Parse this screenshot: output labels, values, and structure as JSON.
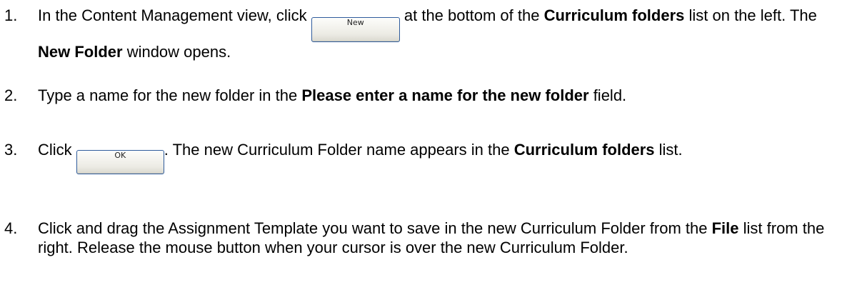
{
  "steps": [
    {
      "number": "1.",
      "text_a": "In the Content Management view, click ",
      "button_label": "New",
      "text_b": " at the bottom of the ",
      "bold_1": "Curriculum folders",
      "text_c": " list on the left. The ",
      "bold_2": "New Folder",
      "text_d": " window opens."
    },
    {
      "number": "2.",
      "text_a": "Type a name for the new folder in the ",
      "bold_1": "Please enter a name for the new folder",
      "text_b": " field."
    },
    {
      "number": "3.",
      "text_a": "Click ",
      "button_label": "OK",
      "text_b": ". The new Curriculum Folder name appears in the ",
      "bold_1": "Curriculum folders",
      "text_c": " list."
    },
    {
      "number": "4.",
      "text_a": "Click and drag the Assignment Template you want to save in the new Curriculum Folder from the ",
      "bold_1": "File",
      "text_b": " list from the right. Release the mouse button when your cursor is over the new Curriculum Folder."
    }
  ]
}
